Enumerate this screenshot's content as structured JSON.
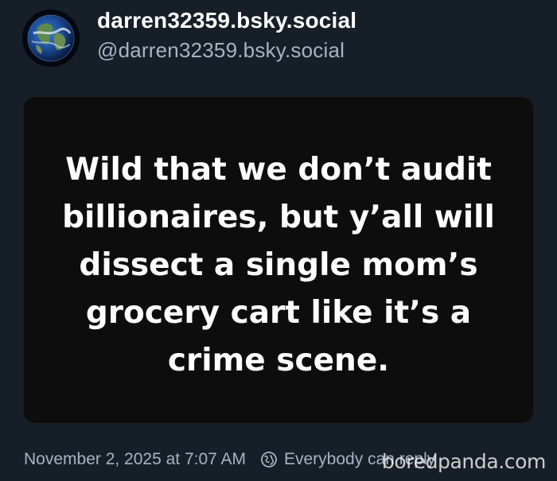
{
  "author": {
    "display_name": "darren32359.bsky.social",
    "handle": "@darren32359.bsky.social",
    "avatar_icon": "earth-globe-icon"
  },
  "post_image": {
    "lines": [
      "Wild that we don’t audit",
      "billionaires, but y’all will",
      "dissect a single mom’s",
      "grocery cart like it’s a",
      "crime scene."
    ],
    "background_color": "#0d0d0e",
    "text_color": "#ffffff"
  },
  "meta": {
    "timestamp": "November 2, 2025 at 7:07 AM",
    "reply_setting": "Everybody can reply",
    "reply_icon": "globe-icon"
  },
  "watermark": {
    "text": "boredpanda.com"
  },
  "colors": {
    "background": "#161e27",
    "secondary_text": "#a7b3c3"
  }
}
